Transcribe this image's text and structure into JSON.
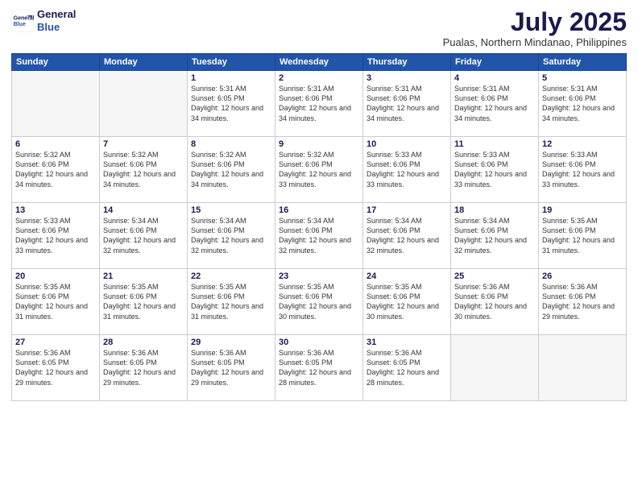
{
  "logo": {
    "line1": "General",
    "line2": "Blue"
  },
  "title": "July 2025",
  "subtitle": "Pualas, Northern Mindanao, Philippines",
  "weekdays": [
    "Sunday",
    "Monday",
    "Tuesday",
    "Wednesday",
    "Thursday",
    "Friday",
    "Saturday"
  ],
  "weeks": [
    [
      {
        "day": "",
        "empty": true
      },
      {
        "day": "",
        "empty": true
      },
      {
        "day": "1",
        "sunrise": "5:31 AM",
        "sunset": "6:05 PM",
        "daylight": "12 hours and 34 minutes."
      },
      {
        "day": "2",
        "sunrise": "5:31 AM",
        "sunset": "6:06 PM",
        "daylight": "12 hours and 34 minutes."
      },
      {
        "day": "3",
        "sunrise": "5:31 AM",
        "sunset": "6:06 PM",
        "daylight": "12 hours and 34 minutes."
      },
      {
        "day": "4",
        "sunrise": "5:31 AM",
        "sunset": "6:06 PM",
        "daylight": "12 hours and 34 minutes."
      },
      {
        "day": "5",
        "sunrise": "5:31 AM",
        "sunset": "6:06 PM",
        "daylight": "12 hours and 34 minutes."
      }
    ],
    [
      {
        "day": "6",
        "sunrise": "5:32 AM",
        "sunset": "6:06 PM",
        "daylight": "12 hours and 34 minutes."
      },
      {
        "day": "7",
        "sunrise": "5:32 AM",
        "sunset": "6:06 PM",
        "daylight": "12 hours and 34 minutes."
      },
      {
        "day": "8",
        "sunrise": "5:32 AM",
        "sunset": "6:06 PM",
        "daylight": "12 hours and 34 minutes."
      },
      {
        "day": "9",
        "sunrise": "5:32 AM",
        "sunset": "6:06 PM",
        "daylight": "12 hours and 33 minutes."
      },
      {
        "day": "10",
        "sunrise": "5:33 AM",
        "sunset": "6:06 PM",
        "daylight": "12 hours and 33 minutes."
      },
      {
        "day": "11",
        "sunrise": "5:33 AM",
        "sunset": "6:06 PM",
        "daylight": "12 hours and 33 minutes."
      },
      {
        "day": "12",
        "sunrise": "5:33 AM",
        "sunset": "6:06 PM",
        "daylight": "12 hours and 33 minutes."
      }
    ],
    [
      {
        "day": "13",
        "sunrise": "5:33 AM",
        "sunset": "6:06 PM",
        "daylight": "12 hours and 33 minutes."
      },
      {
        "day": "14",
        "sunrise": "5:34 AM",
        "sunset": "6:06 PM",
        "daylight": "12 hours and 32 minutes."
      },
      {
        "day": "15",
        "sunrise": "5:34 AM",
        "sunset": "6:06 PM",
        "daylight": "12 hours and 32 minutes."
      },
      {
        "day": "16",
        "sunrise": "5:34 AM",
        "sunset": "6:06 PM",
        "daylight": "12 hours and 32 minutes."
      },
      {
        "day": "17",
        "sunrise": "5:34 AM",
        "sunset": "6:06 PM",
        "daylight": "12 hours and 32 minutes."
      },
      {
        "day": "18",
        "sunrise": "5:34 AM",
        "sunset": "6:06 PM",
        "daylight": "12 hours and 32 minutes."
      },
      {
        "day": "19",
        "sunrise": "5:35 AM",
        "sunset": "6:06 PM",
        "daylight": "12 hours and 31 minutes."
      }
    ],
    [
      {
        "day": "20",
        "sunrise": "5:35 AM",
        "sunset": "6:06 PM",
        "daylight": "12 hours and 31 minutes."
      },
      {
        "day": "21",
        "sunrise": "5:35 AM",
        "sunset": "6:06 PM",
        "daylight": "12 hours and 31 minutes."
      },
      {
        "day": "22",
        "sunrise": "5:35 AM",
        "sunset": "6:06 PM",
        "daylight": "12 hours and 31 minutes."
      },
      {
        "day": "23",
        "sunrise": "5:35 AM",
        "sunset": "6:06 PM",
        "daylight": "12 hours and 30 minutes."
      },
      {
        "day": "24",
        "sunrise": "5:35 AM",
        "sunset": "6:06 PM",
        "daylight": "12 hours and 30 minutes."
      },
      {
        "day": "25",
        "sunrise": "5:36 AM",
        "sunset": "6:06 PM",
        "daylight": "12 hours and 30 minutes."
      },
      {
        "day": "26",
        "sunrise": "5:36 AM",
        "sunset": "6:06 PM",
        "daylight": "12 hours and 29 minutes."
      }
    ],
    [
      {
        "day": "27",
        "sunrise": "5:36 AM",
        "sunset": "6:05 PM",
        "daylight": "12 hours and 29 minutes."
      },
      {
        "day": "28",
        "sunrise": "5:36 AM",
        "sunset": "6:05 PM",
        "daylight": "12 hours and 29 minutes."
      },
      {
        "day": "29",
        "sunrise": "5:36 AM",
        "sunset": "6:05 PM",
        "daylight": "12 hours and 29 minutes."
      },
      {
        "day": "30",
        "sunrise": "5:36 AM",
        "sunset": "6:05 PM",
        "daylight": "12 hours and 28 minutes."
      },
      {
        "day": "31",
        "sunrise": "5:36 AM",
        "sunset": "6:05 PM",
        "daylight": "12 hours and 28 minutes."
      },
      {
        "day": "",
        "empty": true
      },
      {
        "day": "",
        "empty": true
      }
    ]
  ]
}
